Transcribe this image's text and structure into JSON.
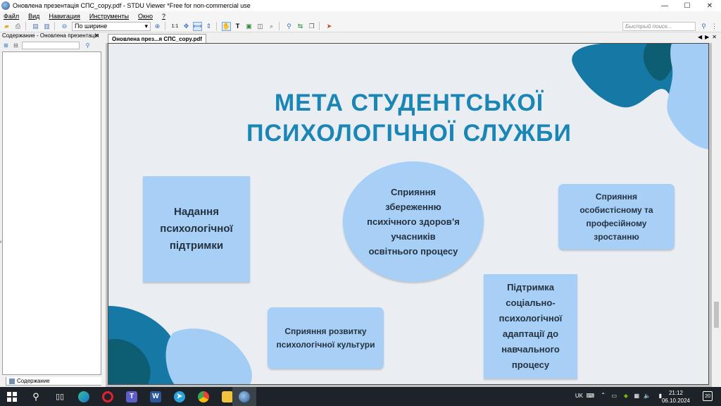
{
  "window": {
    "title": "Оновлена презентація СПС_copy.pdf - STDU Viewer *Free for non-commercial use",
    "controls": {
      "minimize": "—",
      "maximize": "☐",
      "close": "✕"
    }
  },
  "menu": {
    "items": [
      "Файл",
      "Вид",
      "Навигация",
      "Инструменты",
      "Окно",
      "?"
    ]
  },
  "toolbar": {
    "zoom_label": "По ширине",
    "actual_size": "1:1",
    "search_placeholder": "Быстрый поиск..."
  },
  "sidebar": {
    "header": "Содержание - Оновлена презентація",
    "close": "✕",
    "tab_label": "Содержание"
  },
  "document": {
    "tab_label": "Оновлена през...я СПС_copy.pdf",
    "nav": [
      "◀",
      "▶",
      "✕"
    ]
  },
  "slide": {
    "title_line1": "МЕТА СТУДЕНТСЬКОЇ",
    "title_line2": "ПСИХОЛОГІЧНОЇ СЛУЖБИ",
    "card1": [
      "Надання",
      "психологічної",
      "підтримки"
    ],
    "card2": [
      "Сприяння",
      "збереженню",
      "психічного здоров’я",
      "учасників",
      "освітнього процесу"
    ],
    "card3": [
      "Сприяння",
      "особистісному та",
      "професійному",
      "зростанню"
    ],
    "card4": [
      "Підтримка",
      "соціально-",
      "психологічної",
      "адаптації до",
      "навчального",
      "процесу"
    ],
    "card5": [
      "Сприяння розвитку",
      "психологічної культури"
    ],
    "colors": {
      "title": "#1a86b6",
      "card": "#a8cff6",
      "blob_dark": "#1678a4",
      "blob_deep": "#0d5d73",
      "blob_light": "#a3cdf5"
    }
  },
  "taskbar": {
    "apps": [
      "windows-start",
      "search",
      "task-view",
      "edge",
      "opera",
      "teams",
      "word",
      "telegram",
      "chrome",
      "file-explorer",
      "stdu-viewer"
    ],
    "tray_language": "UK",
    "clock_time": "21:12",
    "clock_date": "06.10.2024",
    "notification_count": "20"
  }
}
